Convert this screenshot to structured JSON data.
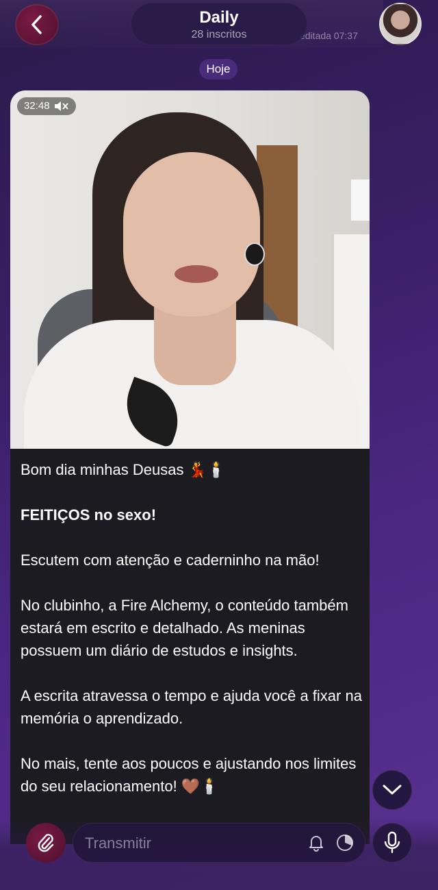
{
  "header": {
    "title": "Daily",
    "subtitle": "28 inscritos",
    "edited_label": "editada 07:37"
  },
  "date_chip": "Hoje",
  "video": {
    "duration": "32:48",
    "muted": true
  },
  "message": {
    "line1": "Bom dia minhas Deusas 💃🕯️",
    "line2": "FEITIÇOS no sexo!",
    "line3": "Escutem com atenção e caderninho na mão!",
    "line4": "No clubinho, a Fire Alchemy, o conteúdo também estará em escrito e detalhado. As meninas possuem um diário de estudos e insights.",
    "line5": "A escrita atravessa o tempo e ajuda você a fixar na memória o aprendizado.",
    "line6": "No mais, tente aos poucos e ajustando nos limites do seu relacionamento! 🤎🕯️"
  },
  "input": {
    "placeholder": "Transmitir"
  },
  "icons": {
    "back": "chevron-left-icon",
    "attach": "paperclip-icon",
    "bell": "bell-icon",
    "timer": "timer-icon",
    "mic": "microphone-icon",
    "scroll": "chevron-down-icon"
  },
  "colors": {
    "accent": "#7b1a45",
    "bubble": "#1c1b22",
    "date_chip": "#4a2a7a"
  }
}
